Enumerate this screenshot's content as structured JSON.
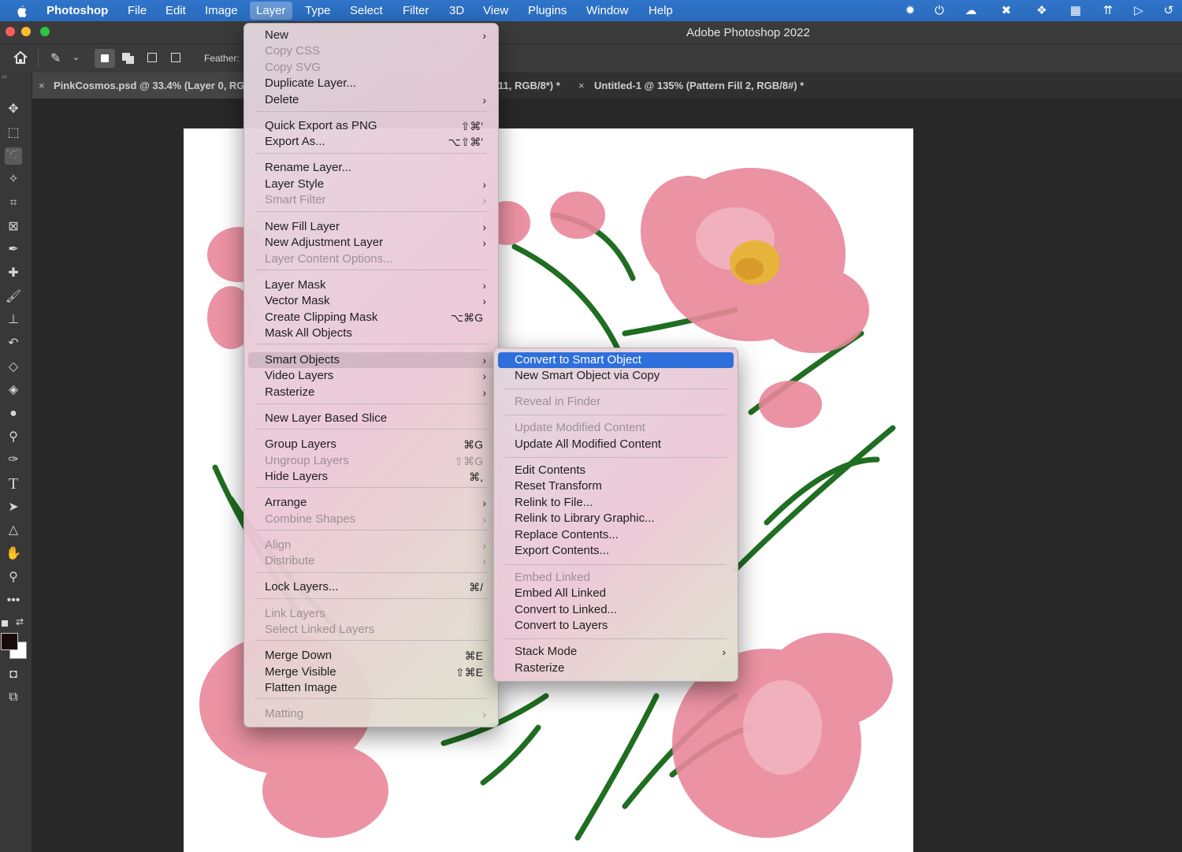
{
  "menubar": {
    "apple": "",
    "items": [
      "Photoshop",
      "File",
      "Edit",
      "Image",
      "Layer",
      "Type",
      "Select",
      "Filter",
      "3D",
      "View",
      "Plugins",
      "Window",
      "Help"
    ]
  },
  "titlebar": {
    "title": "Adobe Photoshop 2022"
  },
  "options": {
    "feather_label": "Feather:"
  },
  "tabs": [
    {
      "label": "PinkCosmos.psd @ 33.4% (Layer 0, RG"
    },
    {
      "label": "11, RGB/8*) *"
    },
    {
      "label": "Untitled-1 @ 135% (Pattern Fill 2, RGB/8#) *"
    }
  ],
  "layer_menu": {
    "items": [
      {
        "label": "New",
        "arrow": "›"
      },
      {
        "label": "Copy CSS",
        "disabled": true
      },
      {
        "label": "Copy SVG",
        "disabled": true
      },
      {
        "label": "Duplicate Layer..."
      },
      {
        "label": "Delete",
        "arrow": "›"
      },
      {
        "label": "Quick Export as PNG",
        "shortcut": "⇧⌘'"
      },
      {
        "label": "Export As...",
        "shortcut": "⌥⇧⌘'"
      },
      {
        "label": "Rename Layer..."
      },
      {
        "label": "Layer Style",
        "arrow": "›"
      },
      {
        "label": "Smart Filter",
        "arrow": "›",
        "disabled": true
      },
      {
        "label": "New Fill Layer",
        "arrow": "›"
      },
      {
        "label": "New Adjustment Layer",
        "arrow": "›"
      },
      {
        "label": "Layer Content Options...",
        "disabled": true
      },
      {
        "label": "Layer Mask",
        "arrow": "›"
      },
      {
        "label": "Vector Mask",
        "arrow": "›"
      },
      {
        "label": "Create Clipping Mask",
        "shortcut": "⌥⌘G"
      },
      {
        "label": "Mask All Objects"
      },
      {
        "label": "Smart Objects",
        "arrow": "›",
        "highlighted": true
      },
      {
        "label": "Video Layers",
        "arrow": "›"
      },
      {
        "label": "Rasterize",
        "arrow": "›"
      },
      {
        "label": "New Layer Based Slice"
      },
      {
        "label": "Group Layers",
        "shortcut": "⌘G"
      },
      {
        "label": "Ungroup Layers",
        "shortcut": "⇧⌘G",
        "disabled": true
      },
      {
        "label": "Hide Layers",
        "shortcut": "⌘,"
      },
      {
        "label": "Arrange",
        "arrow": "›"
      },
      {
        "label": "Combine Shapes",
        "arrow": "›",
        "disabled": true
      },
      {
        "label": "Align",
        "arrow": "›",
        "disabled": true
      },
      {
        "label": "Distribute",
        "arrow": "›",
        "disabled": true
      },
      {
        "label": "Lock Layers...",
        "shortcut": "⌘/"
      },
      {
        "label": "Link Layers",
        "disabled": true
      },
      {
        "label": "Select Linked Layers",
        "disabled": true
      },
      {
        "label": "Merge Down",
        "shortcut": "⌘E"
      },
      {
        "label": "Merge Visible",
        "shortcut": "⇧⌘E"
      },
      {
        "label": "Flatten Image"
      },
      {
        "label": "Matting",
        "arrow": "›",
        "disabled": true
      }
    ]
  },
  "smart_objects_menu": {
    "items": [
      {
        "label": "Convert to Smart Object",
        "selected": true
      },
      {
        "label": "New Smart Object via Copy"
      },
      {
        "label": "Reveal in Finder",
        "disabled": true
      },
      {
        "label": "Update Modified Content",
        "disabled": true
      },
      {
        "label": "Update All Modified Content"
      },
      {
        "label": "Edit Contents"
      },
      {
        "label": "Reset Transform"
      },
      {
        "label": "Relink to File..."
      },
      {
        "label": "Relink to Library Graphic..."
      },
      {
        "label": "Replace Contents..."
      },
      {
        "label": "Export Contents..."
      },
      {
        "label": "Embed Linked",
        "disabled": true
      },
      {
        "label": "Embed All Linked"
      },
      {
        "label": "Convert to Linked..."
      },
      {
        "label": "Convert to Layers"
      },
      {
        "label": "Stack Mode",
        "arrow": "›"
      },
      {
        "label": "Rasterize"
      }
    ]
  }
}
